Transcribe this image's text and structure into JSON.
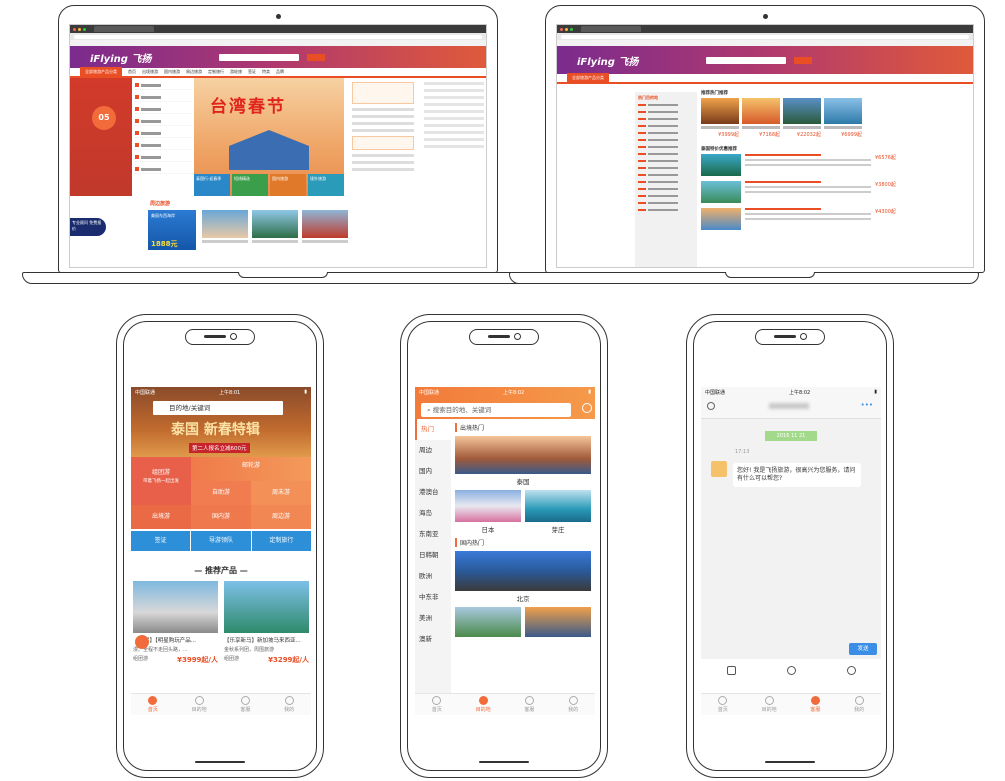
{
  "laptop1": {
    "logo": "iFlying 飞扬",
    "nav_category": "全部旅游产品分类",
    "nav_items": [
      "首页",
      "出境旅游",
      "国内旅游",
      "周边旅游",
      "定制旅行",
      "游轮旅",
      "签证",
      "特卖",
      "品牌"
    ],
    "date_badge": "05",
    "banner_title": "台湾春节",
    "banner_tiles": [
      "泰国行·迎春季",
      "短线精选",
      "国内旅游",
      "境外旅游"
    ],
    "section_title": "周边旅游",
    "promo_text": "美丽东西海岸",
    "promo_price": "1888元",
    "badge_text": "专业顾问 免费报价"
  },
  "laptop2": {
    "logo": "iFlying 飞扬",
    "nav_category": "全部旅游产品分类",
    "side_title": "热门目的地",
    "main_title": "推荐热门推荐",
    "card_prices": [
      "¥3999起",
      "¥7168起",
      "¥22032起",
      "¥6999起"
    ],
    "list_title": "泰国特价优惠推荐",
    "list_prices": [
      "¥6576起",
      "¥3800起",
      "¥4300起"
    ]
  },
  "phone1": {
    "carrier": "中国联通",
    "time": "上午8:01",
    "search_placeholder": "目的地/关键词",
    "hero_title": "泰国 新春特辑",
    "hero_sub": "第二人报名立减600元",
    "grid": [
      "组团游",
      "邮轮游",
      "自助游",
      "周末游",
      "出境游",
      "国内游",
      "周边游"
    ],
    "grid_sub": "带着飞扬一起出发",
    "blue_row": [
      "签证",
      "导游领队",
      "定制旅行"
    ],
    "rec_title": "— 推荐产品 —",
    "products": [
      {
        "name": "【自驾】【明星购玩产品...",
        "desc": "漫。全程不走回头路，...",
        "from": "组团游",
        "price": "¥3999起/人"
      },
      {
        "name": "【乐享新马】新加坡马来西亚...",
        "desc": "金秋系列团，周围旅游",
        "from": "组团游",
        "price": "¥3299起/人"
      }
    ],
    "tabs": [
      "首页",
      "目的地",
      "客服",
      "我的"
    ]
  },
  "phone2": {
    "carrier": "中国联通",
    "time": "上午8:02",
    "search_placeholder": "搜索目的地、关键词",
    "left_menu": [
      "热门",
      "周边",
      "国内",
      "港澳台",
      "海岛",
      "东南亚",
      "日韩朝",
      "欧洲",
      "中东非",
      "美洲",
      "澳新"
    ],
    "section1": "出境热门",
    "dest_thailand": "泰国",
    "dest_japan": "日本",
    "dest_nhatrang": "芽庄",
    "section2": "国内热门",
    "dest_beijing": "北京",
    "tabs": [
      "首页",
      "目的地",
      "客服",
      "我的"
    ]
  },
  "phone3": {
    "carrier": "中国联通",
    "time": "上午8:02",
    "date_chip": "2016 11 21",
    "msg_time": "17:13",
    "message": "您好! 我是飞扬旅游，很高兴为您服务，请问有什么可以帮您?",
    "send_label": "发送",
    "tabs": [
      "首页",
      "目的地",
      "客服",
      "我的"
    ]
  },
  "colors": {
    "brand_orange": "#f26b3a",
    "brand_red": "#e94e25",
    "purple": "#7b2b8e",
    "blue": "#2d8fd8"
  }
}
